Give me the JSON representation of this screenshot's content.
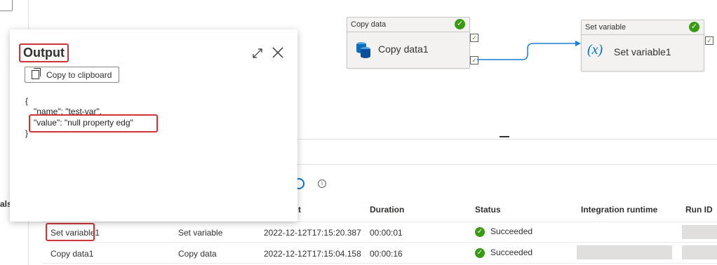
{
  "canvas": {
    "copy_activity": {
      "type": "Copy data",
      "name": "Copy data1",
      "status": "succeeded"
    },
    "setvar_activity": {
      "type": "Set variable",
      "name": "Set variable1",
      "icon_text": "(x)",
      "status": "succeeded"
    }
  },
  "left_panel": {
    "label": "als"
  },
  "output_panel": {
    "title": "Output",
    "copy_button": "Copy to clipboard",
    "json_open": "{",
    "json_line1": "\"name\": \"test-var\",",
    "json_line2": "\"value\": \"null property edg\"",
    "json_close": "}"
  },
  "table": {
    "partial_header": "t",
    "headers": {
      "duration": "Duration",
      "status": "Status",
      "runtime": "Integration runtime",
      "run_id": "Run ID"
    },
    "rows": [
      {
        "name": "Set variable1",
        "type": "Set variable",
        "start": "2022-12-12T17:15:20.387",
        "duration": "00:00:01",
        "status": "Succeeded"
      },
      {
        "name": "Copy data1",
        "type": "Copy data",
        "start": "2022-12-12T17:15:04.158",
        "duration": "00:00:16",
        "status": "Succeeded"
      }
    ]
  },
  "colors": {
    "success": "#3a9a14",
    "highlight": "#d13438",
    "link": "#0078d4"
  }
}
